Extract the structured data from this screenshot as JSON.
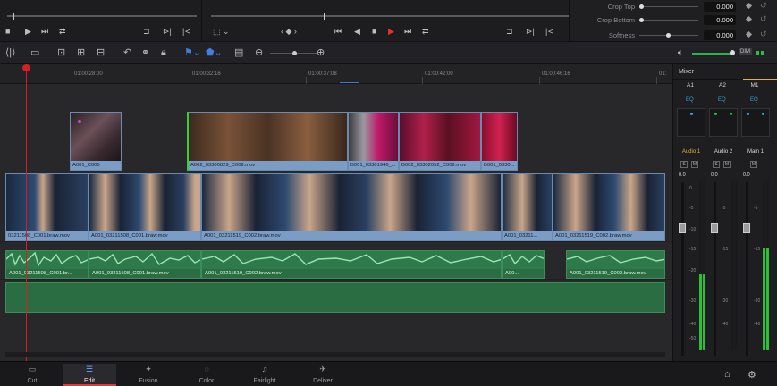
{
  "inspector": {
    "rows": [
      {
        "label": "Crop Top",
        "value": "0.000"
      },
      {
        "label": "Crop Bottom",
        "value": "0.000"
      },
      {
        "label": "Softness",
        "value": "0.000"
      }
    ]
  },
  "timeline": {
    "ruler_labels": [
      "01:00:28:00",
      "01:00:32:16",
      "01:00:37:08",
      "01:00:42:00",
      "01:00:46:16",
      "01:"
    ],
    "video_clips": [
      {
        "name": "A001_C005"
      },
      {
        "name": "A002_03300829_C009.mov"
      },
      {
        "name": "B001_03301946_..."
      },
      {
        "name": "B002_03302052_C009.mov"
      },
      {
        "name": "B001_0330..."
      },
      {
        "name": "03211508_C001.braw.mov"
      },
      {
        "name": "A001_03211508_C001.braw.mov"
      },
      {
        "name": "A001_03211519_C002.braw.mov"
      },
      {
        "name": "A001_03211..."
      },
      {
        "name": "A001_03211519_C002.braw.mov"
      }
    ],
    "audio_clips": [
      {
        "name": "A001_03211508_C001.br..."
      },
      {
        "name": "A001_03211508_C001.braw.mov"
      },
      {
        "name": "A001_03211519_C002.braw.mov"
      },
      {
        "name": "A00..."
      },
      {
        "name": "A001_03211519_C002.braw.mov"
      }
    ]
  },
  "mixer": {
    "title": "Mixer",
    "buses": [
      {
        "label": "A1"
      },
      {
        "label": "A2"
      },
      {
        "label": "M1"
      }
    ],
    "eq_label": "EQ",
    "channels": [
      {
        "name": "Audio 1",
        "color": "#e7b23a",
        "gain": "0.0",
        "level": 0.45
      },
      {
        "name": "Audio 2",
        "color": "#dcdcdc",
        "gain": "0.0",
        "level": 0.0
      },
      {
        "name": "Main 1",
        "color": "#dcdcdc",
        "gain": "0.0",
        "level": 0.6
      }
    ],
    "solo": "S",
    "mute": "M",
    "scale": [
      "0",
      "-5",
      "-10",
      "-15",
      "-20",
      "-30",
      "-40",
      "-50"
    ],
    "dim_label": "DIM"
  },
  "pages": [
    {
      "label": "Cut",
      "icon": "cut-page-icon"
    },
    {
      "label": "Edit",
      "icon": "edit-page-icon",
      "active": true
    },
    {
      "label": "Fusion",
      "icon": "fusion-page-icon"
    },
    {
      "label": "Color",
      "icon": "color-page-icon"
    },
    {
      "label": "Fairlight",
      "icon": "fairlight-page-icon"
    },
    {
      "label": "Deliver",
      "icon": "deliver-page-icon"
    }
  ],
  "colors": {
    "accent_red": "#d93b3b",
    "video_clip": "#7b9cc4",
    "audio_clip": "#2e7a4a",
    "meter_green": "#27c23a",
    "playhead": "#d42020"
  }
}
